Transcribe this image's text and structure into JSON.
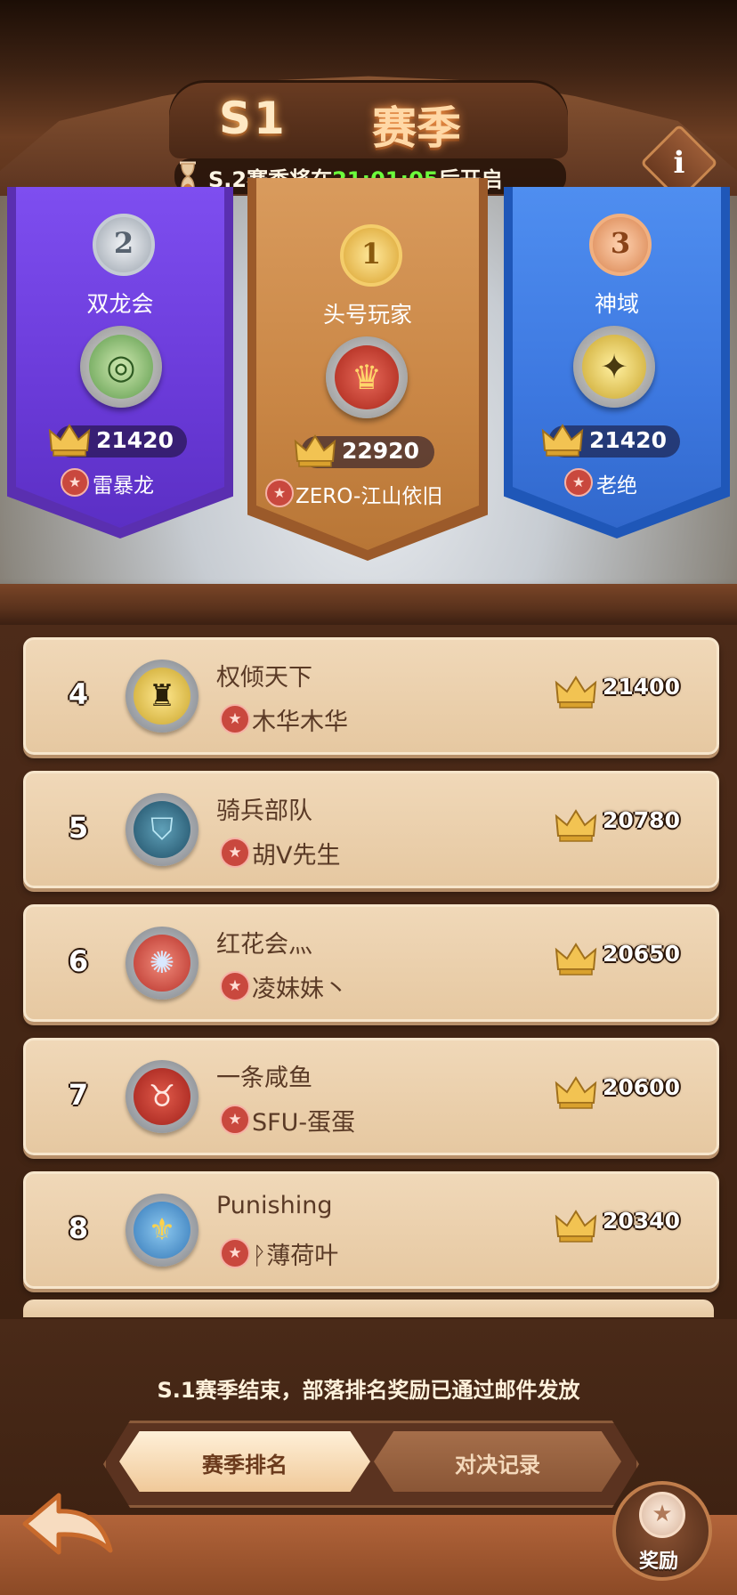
{
  "header": {
    "season_label": "S1",
    "season_word": "赛季",
    "countdown_prefix": "S.2赛季将在",
    "countdown_time": "21:01:05",
    "countdown_suffix": "后开启",
    "info_glyph": "i"
  },
  "podium": [
    {
      "rank": "2",
      "medal": "silver",
      "clan": "双龙会",
      "score": "21420",
      "leader": "雷暴龙",
      "badge_icon": "dragon-icon",
      "color": "#7e4ef0"
    },
    {
      "rank": "1",
      "medal": "gold",
      "clan": "头号玩家",
      "score": "22920",
      "leader": "ZERO-江山依旧",
      "badge_icon": "crown-icon",
      "color": "#d99b5d"
    },
    {
      "rank": "3",
      "medal": "bronze",
      "clan": "神域",
      "score": "21420",
      "leader": "老绝",
      "badge_icon": "eagle-icon",
      "color": "#4f8ef0"
    }
  ],
  "ranking": [
    {
      "rank": "4",
      "clan": "权倾天下",
      "leader": "木华木华",
      "score": "21400",
      "badge_icon": "eagle-icon"
    },
    {
      "rank": "5",
      "clan": "骑兵部队",
      "leader": "胡V先生",
      "score": "20780",
      "badge_icon": "shield-icon"
    },
    {
      "rank": "6",
      "clan": "红花会灬",
      "leader": "凌妹妹丶",
      "score": "20650",
      "badge_icon": "triskelion-icon"
    },
    {
      "rank": "7",
      "clan": "一条咸鱼",
      "leader": "SFU-蛋蛋",
      "score": "20600",
      "badge_icon": "bull-icon"
    },
    {
      "rank": "8",
      "clan": "Punishing",
      "leader": "ᚹ薄荷叶",
      "score": "20340",
      "badge_icon": "fleur-de-lis-icon"
    }
  ],
  "footer": {
    "notice": "S.1赛季结束，部落排名奖励已通过邮件发放",
    "tab_season": "赛季排名",
    "tab_battle": "对决记录",
    "reward_label": "奖励"
  },
  "colors": {
    "accent_green": "#6cff3c",
    "leader_star": "#c9483e",
    "row_bg": "#f0d8b8"
  }
}
